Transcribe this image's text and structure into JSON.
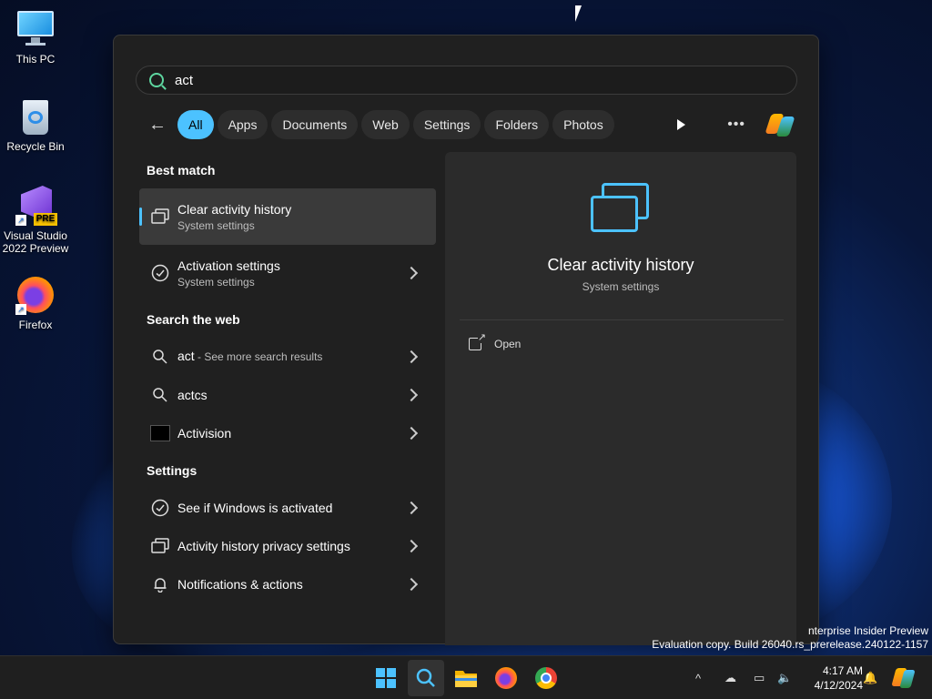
{
  "desktop": {
    "icons": [
      {
        "label_line1": "This PC",
        "label_line2": "",
        "icon": "computer-icon"
      },
      {
        "label_line1": "Recycle Bin",
        "label_line2": "",
        "icon": "recycle-bin-icon"
      },
      {
        "label_line1": "Visual Studio",
        "label_line2": "2022 Preview",
        "icon": "visual-studio-icon",
        "badge": "PRE"
      },
      {
        "label_line1": "Firefox",
        "label_line2": "",
        "icon": "firefox-icon"
      }
    ],
    "watermark_line1": "nterprise Insider Preview",
    "watermark_line2": "Evaluation copy. Build 26040.rs_prerelease.240122-1157"
  },
  "search": {
    "query": "act",
    "filters": [
      "All",
      "Apps",
      "Documents",
      "Web",
      "Settings",
      "Folders",
      "Photos"
    ],
    "active_filter": "All"
  },
  "results": {
    "best_match_heading": "Best match",
    "best_match": [
      {
        "title": "Clear activity history",
        "subtitle": "System settings",
        "icon": "activity-history-icon",
        "selected": true
      },
      {
        "title": "Activation settings",
        "subtitle": "System settings",
        "icon": "check-circle-icon"
      }
    ],
    "web_heading": "Search the web",
    "web": [
      {
        "title": "act",
        "suffix": " - See more search results",
        "icon": "search-icon"
      },
      {
        "title": "actcs",
        "suffix": "",
        "icon": "search-icon"
      },
      {
        "title": "Activision",
        "suffix": "",
        "icon": "activision-logo-icon"
      }
    ],
    "settings_heading": "Settings",
    "settings": [
      {
        "title": "See if Windows is activated",
        "icon": "check-circle-icon"
      },
      {
        "title": "Activity history privacy settings",
        "icon": "activity-history-icon"
      },
      {
        "title": "Notifications & actions",
        "icon": "bell-icon"
      }
    ]
  },
  "detail": {
    "title": "Clear activity history",
    "subtitle": "System settings",
    "action_open": "Open"
  },
  "taskbar": {
    "time": "4:17 AM",
    "date": "4/12/2024",
    "apps": [
      "windows-start-icon",
      "search-icon",
      "file-explorer-icon",
      "firefox-icon",
      "chrome-icon"
    ]
  },
  "colors": {
    "accent": "#4cc2ff",
    "panel_bg": "#202020",
    "detail_bg": "#2b2b2b"
  }
}
